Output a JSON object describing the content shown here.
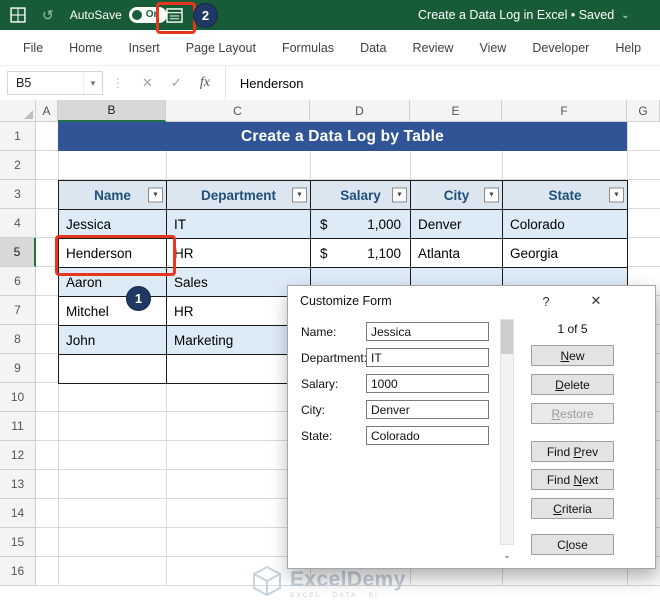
{
  "titlebar": {
    "autosave_label": "AutoSave",
    "autosave_state": "On",
    "doc_title": "Create a Data Log in Excel • Saved"
  },
  "ribbon": {
    "tabs": [
      "File",
      "Home",
      "Insert",
      "Page Layout",
      "Formulas",
      "Data",
      "Review",
      "View",
      "Developer",
      "Help"
    ]
  },
  "formula_bar": {
    "name_box": "B5",
    "content": "Henderson"
  },
  "grid": {
    "col_letters": [
      "A",
      "B",
      "C",
      "D",
      "E",
      "F",
      "G"
    ],
    "row_numbers": [
      "1",
      "2",
      "3",
      "4",
      "5",
      "6",
      "7",
      "8",
      "9",
      "10",
      "11",
      "12",
      "13",
      "14",
      "15",
      "16"
    ]
  },
  "sheet": {
    "title": "Create a Data Log by Table",
    "headers": [
      "Name",
      "Department",
      "Salary",
      "City",
      "State"
    ],
    "rows": [
      {
        "name": "Jessica",
        "department": "IT",
        "currency": "$",
        "salary": "1,000",
        "city": "Denver",
        "state": "Colorado"
      },
      {
        "name": "Henderson",
        "department": "HR",
        "currency": "$",
        "salary": "1,100",
        "city": "Atlanta",
        "state": "Georgia"
      },
      {
        "name": "Aaron",
        "department": "Sales"
      },
      {
        "name": "Mitchel",
        "department": "HR"
      },
      {
        "name": "John",
        "department": "Marketing"
      }
    ]
  },
  "dialog": {
    "title": "Customize Form",
    "record_indicator": "1 of 5",
    "fields": [
      {
        "label": "Name:",
        "value": "Jessica"
      },
      {
        "label": "Department:",
        "value": "IT"
      },
      {
        "label": "Salary:",
        "value": "1000"
      },
      {
        "label": "City:",
        "value": "Denver"
      },
      {
        "label": "State:",
        "value": "Colorado"
      }
    ],
    "buttons": [
      {
        "label": "New",
        "accel": 0,
        "disabled": false
      },
      {
        "label": "Delete",
        "accel": 0,
        "disabled": false
      },
      {
        "label": "Restore",
        "accel": 0,
        "disabled": true
      },
      {
        "label": "Find Prev",
        "accel": 5,
        "disabled": false
      },
      {
        "label": "Find Next",
        "accel": 5,
        "disabled": false
      },
      {
        "label": "Criteria",
        "accel": 0,
        "disabled": false
      },
      {
        "label": "Close",
        "accel": 1,
        "disabled": false
      }
    ]
  },
  "annotations": {
    "step1": "1",
    "step2": "2"
  },
  "watermark": {
    "name": "ExcelDemy",
    "tagline": "EXCEL · DATA · BI"
  },
  "icons": {
    "undo": "↺",
    "title_caret": "⌄",
    "namebox_caret": "▼",
    "divider_dots": "⋮",
    "cancel": "✕",
    "enter": "✓",
    "fx": "fx",
    "filter": "▼",
    "dialog_help": "?",
    "dialog_close": "✕",
    "scroll_down": "⌄"
  },
  "colors": {
    "titlebar_green": "#185C37",
    "annotation_red": "#e6361d",
    "badge_navy": "#1f3864",
    "title_cell_blue": "#305496",
    "band_blue": "#ddebf7",
    "table_header_fill": "#dce6f1",
    "table_header_text": "#1f4e79"
  }
}
